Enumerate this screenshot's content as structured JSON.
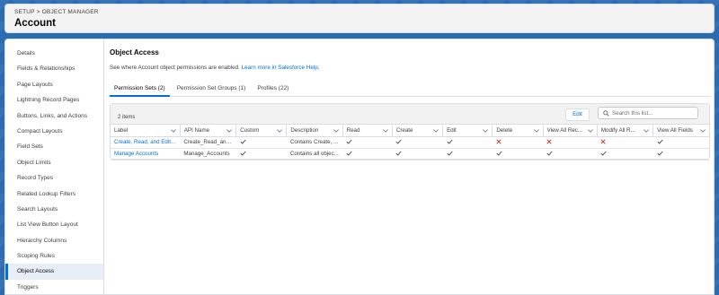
{
  "header": {
    "breadcrumb": [
      "SETUP",
      "OBJECT MANAGER"
    ],
    "title": "Account"
  },
  "sidebar": {
    "items": [
      "Details",
      "Fields & Relationships",
      "Page Layouts",
      "Lightning Record Pages",
      "Buttons, Links, and Actions",
      "Compact Layouts",
      "Field Sets",
      "Object Limits",
      "Record Types",
      "Related Lookup Filters",
      "Search Layouts",
      "List View Button Layout",
      "Hierarchy Columns",
      "Scoping Rules",
      "Object Access",
      "Triggers"
    ],
    "active_index": 14
  },
  "main": {
    "title": "Object Access",
    "description": "See where Account object permissions are enabled.",
    "help_link": "Learn more in Salesforce Help.",
    "tabs": [
      "Permission Sets (2)",
      "Permission Set Groups (1)",
      "Profiles (22)"
    ],
    "active_tab": 0
  },
  "list": {
    "item_count": "2 items",
    "edit_label": "Edit",
    "search_placeholder": "Search this list...",
    "columns": [
      "Label",
      "API Name",
      "Custom",
      "Description",
      "Read",
      "Create",
      "Edit",
      "Delete",
      "View All Rec...",
      "Modify All R...",
      "View All Fields"
    ],
    "rows": [
      {
        "label": "Create, Read, and Edit ...",
        "api_name": "Create_Read_and...",
        "custom": "check",
        "description": "Contains Create, ...",
        "read": "check",
        "create": "check",
        "edit": "check",
        "delete": "cross",
        "view_all_records": "cross",
        "modify_all_records": "cross",
        "view_all_fields": "check"
      },
      {
        "label": "Manage Accounts",
        "api_name": "Manage_Accounts",
        "custom": "check",
        "description": "Contains all objec...",
        "read": "check",
        "create": "check",
        "edit": "check",
        "delete": "check",
        "view_all_records": "check",
        "modify_all_records": "check",
        "view_all_fields": "check"
      }
    ]
  },
  "colors": {
    "brand_blue": "#0070d2",
    "check": "#3e3e3c",
    "cross": "#c23934",
    "background": "#2a6bb2"
  }
}
